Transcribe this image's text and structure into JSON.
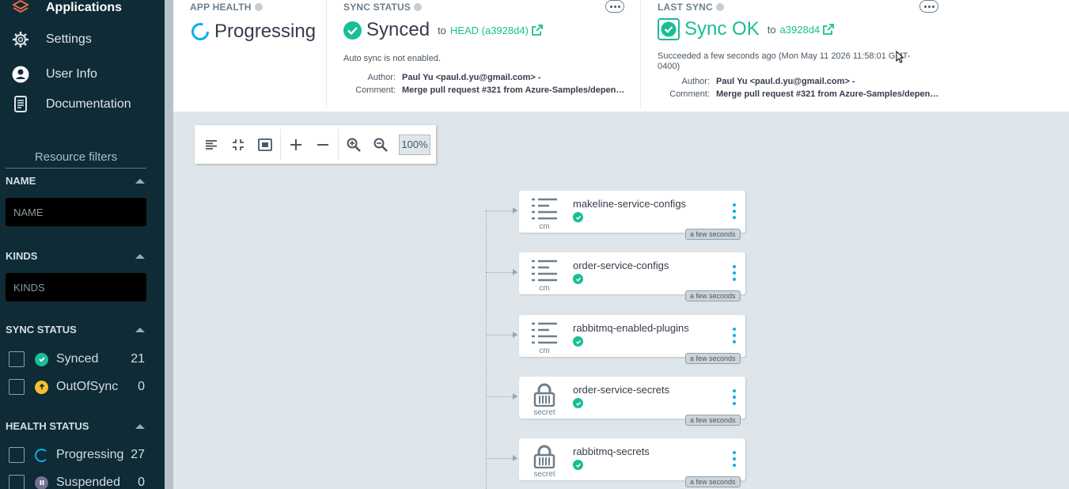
{
  "sidebar": {
    "nav": [
      {
        "label": "Applications",
        "icon": "layers-icon",
        "active": true
      },
      {
        "label": "Settings",
        "icon": "gear-icon"
      },
      {
        "label": "User Info",
        "icon": "user-icon"
      },
      {
        "label": "Documentation",
        "icon": "book-icon"
      }
    ],
    "filters_title": "Resource filters",
    "name_section": {
      "title": "NAME",
      "placeholder": "NAME"
    },
    "kinds_section": {
      "title": "KINDS",
      "placeholder": "KINDS"
    },
    "sync_section": {
      "title": "SYNC STATUS",
      "items": [
        {
          "label": "Synced",
          "count": "21",
          "color": "#18be94"
        },
        {
          "label": "OutOfSync",
          "count": "0",
          "color": "#f4c030"
        }
      ]
    },
    "health_section": {
      "title": "HEALTH STATUS",
      "items": [
        {
          "label": "Progressing",
          "count": "27",
          "color": "#0dadea"
        },
        {
          "label": "Suspended",
          "count": "0",
          "color": "#766f94"
        }
      ]
    }
  },
  "header": {
    "app_health": {
      "title": "APP HEALTH",
      "status": "Progressing"
    },
    "sync_status": {
      "title": "SYNC STATUS",
      "status": "Synced",
      "to": "to",
      "revision": "HEAD (a3928d4)",
      "note": "Auto sync is not enabled.",
      "author_key": "Author:",
      "author": "Paul Yu <paul.d.yu@gmail.com> -",
      "comment_key": "Comment:",
      "comment": "Merge pull request #321 from Azure-Samples/depen…"
    },
    "last_sync": {
      "title": "LAST SYNC",
      "status": "Sync OK",
      "to": "to",
      "revision": "a3928d4",
      "note_line1": "Succeeded a few seconds ago (Mon May 11 2026 11:58:01 GMT-",
      "note_line2": "0400)",
      "author_key": "Author:",
      "author": "Paul Yu <paul.d.yu@gmail.com> -",
      "comment_key": "Comment:",
      "comment": "Merge pull request #321 from Azure-Samples/depen…"
    }
  },
  "toolbar": {
    "zoom": "100%"
  },
  "nodes": [
    {
      "name": "makeline-service-configs",
      "kind": "cm",
      "age": "a few seconds"
    },
    {
      "name": "order-service-configs",
      "kind": "cm",
      "age": "a few seconds"
    },
    {
      "name": "rabbitmq-enabled-plugins",
      "kind": "cm",
      "age": "a few seconds"
    },
    {
      "name": "order-service-secrets",
      "kind": "secret",
      "age": "a few seconds"
    },
    {
      "name": "rabbitmq-secrets",
      "kind": "secret",
      "age": "a few seconds"
    }
  ],
  "colors": {
    "accent": "#18be94",
    "sidebar_bg": "#0e2b36",
    "canvas_bg": "#dee6eb",
    "link": "#0dadea"
  }
}
